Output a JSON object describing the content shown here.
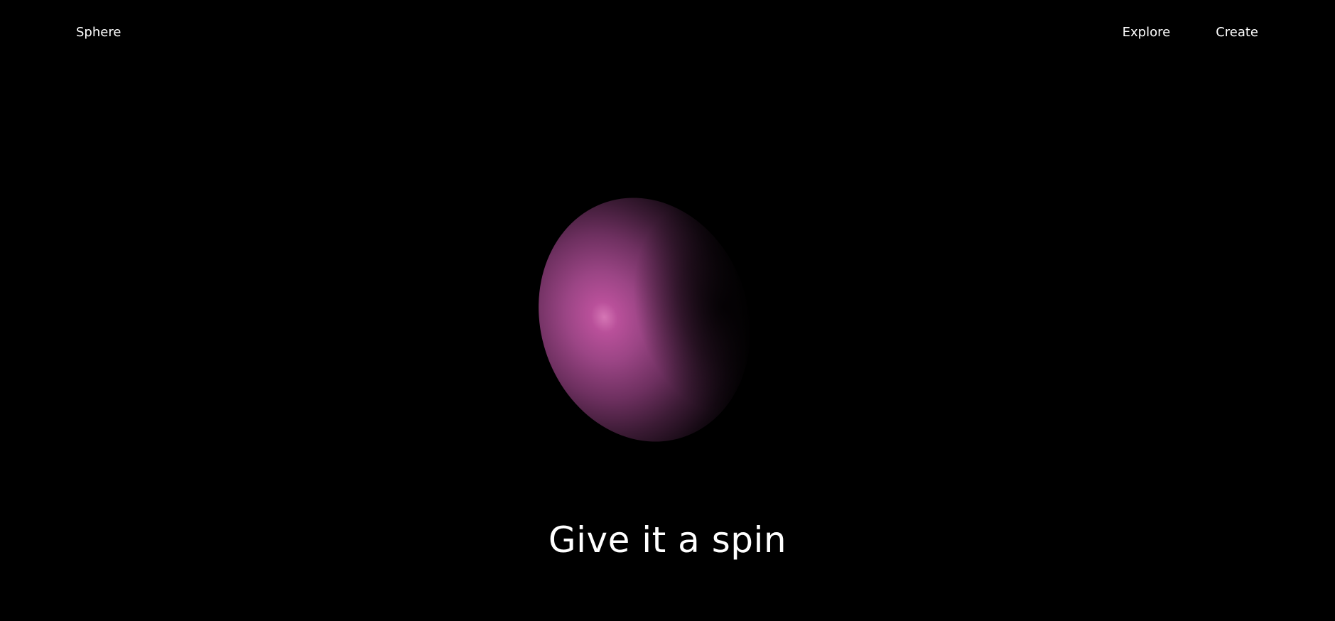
{
  "header": {
    "brand": "Sphere",
    "nav": [
      {
        "label": "Explore"
      },
      {
        "label": "Create"
      }
    ]
  },
  "hero": {
    "headline": "Give it a spin",
    "sphere_color": "#b9509a"
  },
  "colors": {
    "background": "#000000",
    "text": "#ffffff",
    "accent": "#b9509a"
  }
}
